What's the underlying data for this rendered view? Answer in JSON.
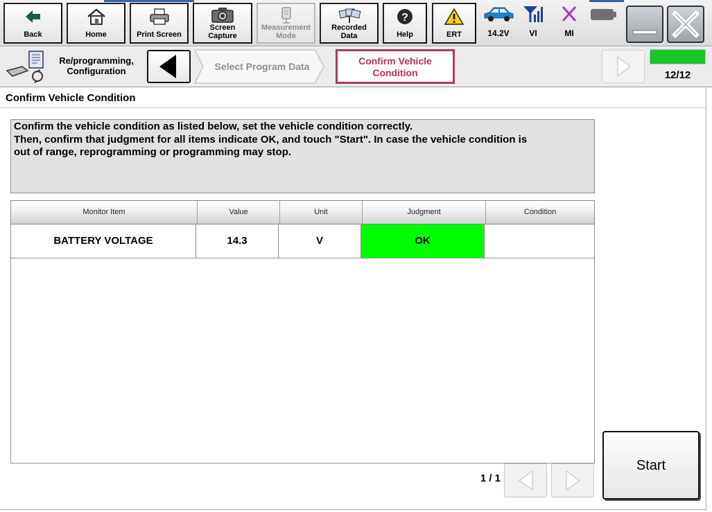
{
  "toolbar": {
    "back": "Back",
    "home": "Home",
    "print": "Print Screen",
    "screen_capture": [
      "Screen",
      "Capture"
    ],
    "measurement": [
      "Measurement",
      "Mode"
    ],
    "recorded": [
      "Recorded",
      "Data"
    ],
    "help": "Help",
    "ert": "ERT",
    "status": {
      "battery_voltage": "14.2V",
      "vi": "VI",
      "mi": "MI"
    }
  },
  "nav": {
    "section_label": [
      "Re/programming,",
      "Configuration"
    ],
    "steps": {
      "previous": "Select Program Data",
      "current": [
        "Confirm Vehicle",
        "Condition"
      ]
    },
    "progress": {
      "current": 12,
      "total": 12,
      "text": "12/12",
      "fill_fraction": 1.0,
      "color": "#19c52a"
    }
  },
  "page": {
    "title": "Confirm Vehicle Condition",
    "instruction": [
      "Confirm the vehicle condition as listed below, set the vehicle condition correctly.",
      "Then, confirm that judgment for all items indicate OK, and touch \"Start\". In case the vehicle condition is",
      "out of range, reprogramming or programming may stop."
    ]
  },
  "table": {
    "headers": [
      "Monitor Item",
      "Value",
      "Unit",
      "Judgment",
      "Condition"
    ],
    "rows": [
      {
        "monitor_item": "BATTERY VOLTAGE",
        "value": "14.3",
        "unit": "V",
        "judgment": "OK",
        "condition": ""
      }
    ],
    "ok_color": "#00ff00"
  },
  "pager": {
    "indicator": "1 / 1"
  },
  "actions": {
    "start": "Start"
  },
  "colors": {
    "accent": "#c0304f",
    "step_border": "#b03a5b"
  }
}
